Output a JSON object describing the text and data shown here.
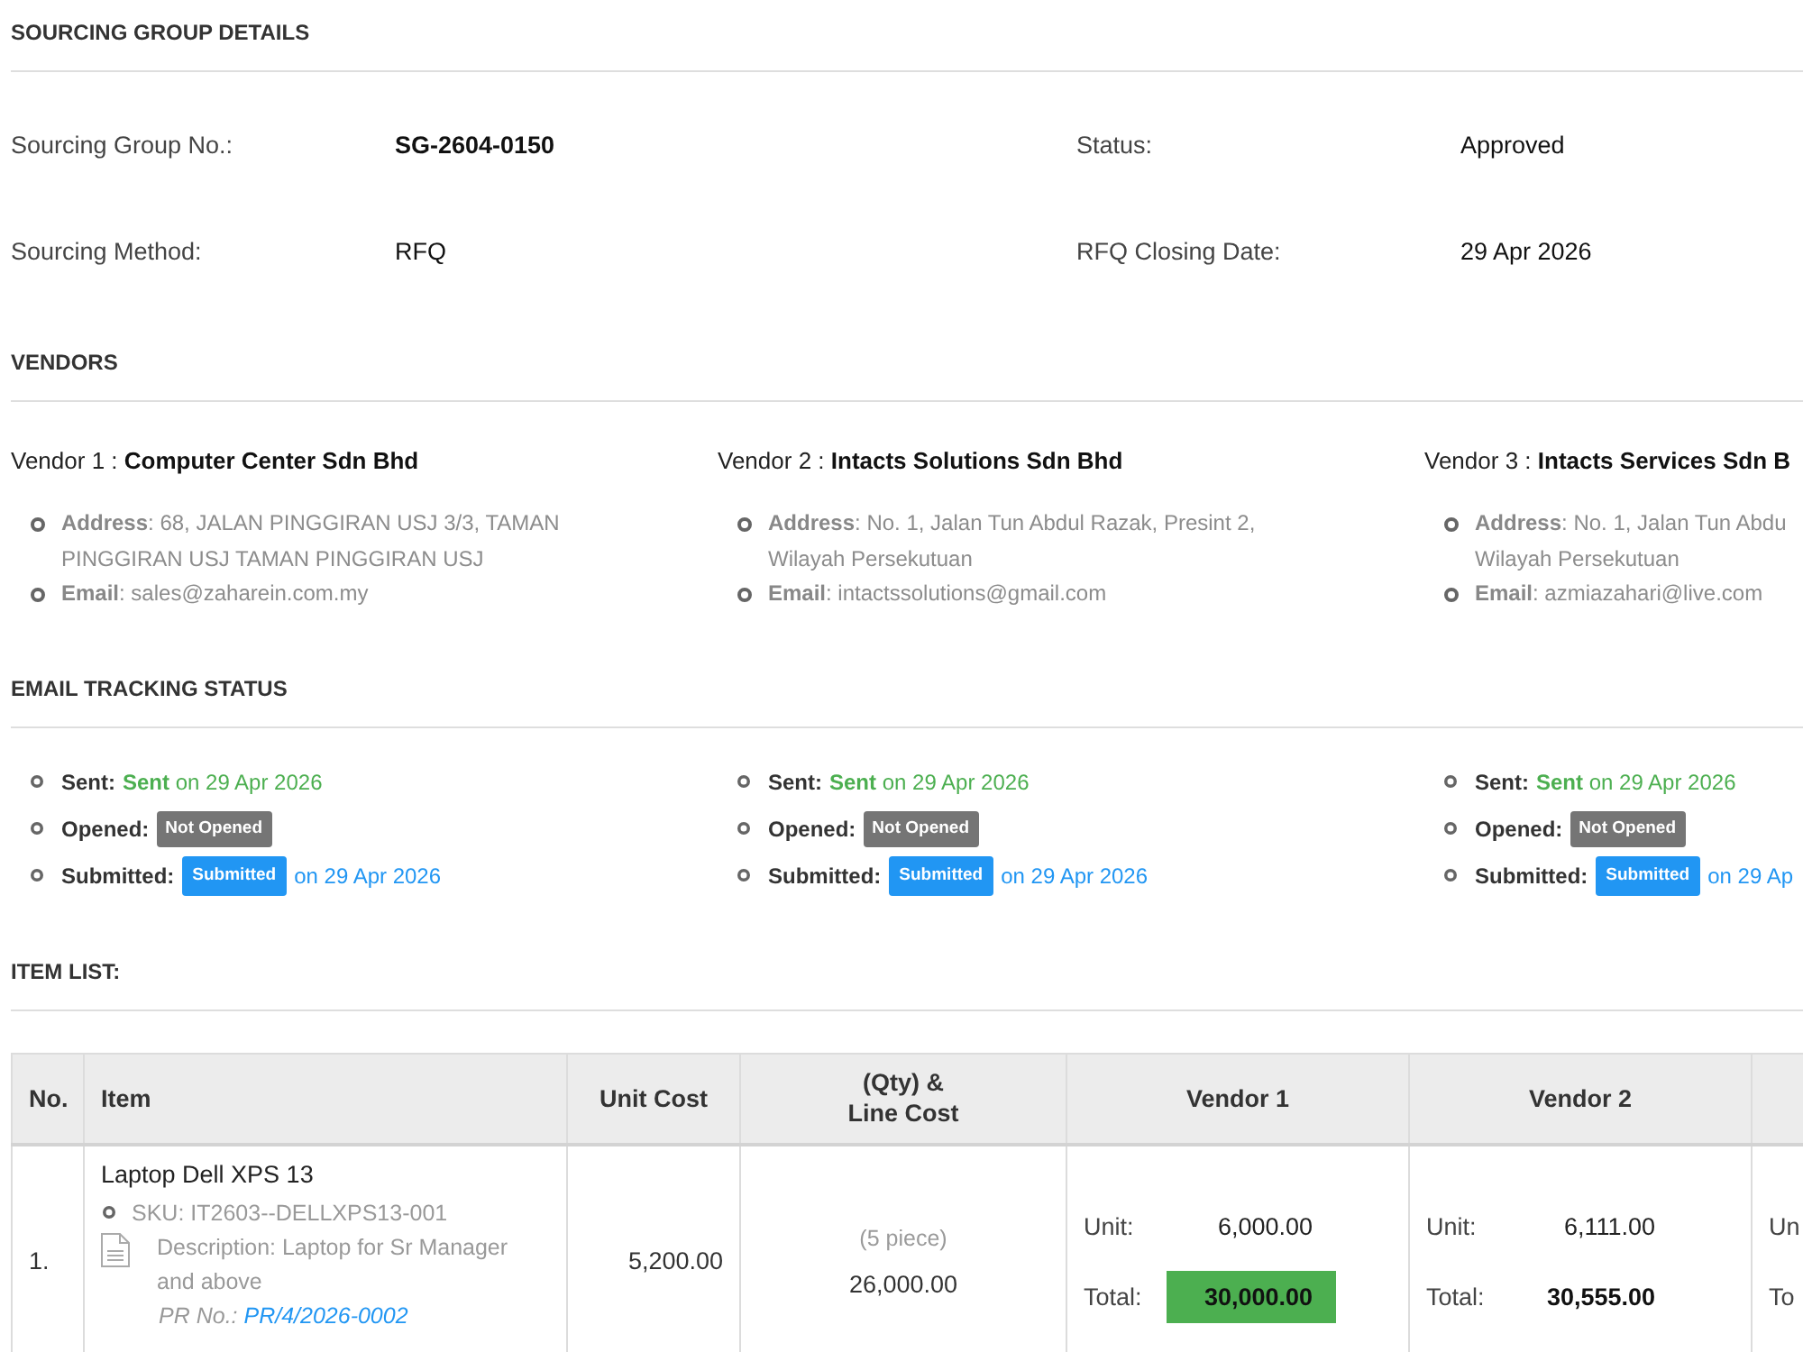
{
  "details": {
    "title": "SOURCING GROUP DETAILS",
    "fields": [
      {
        "label": "Sourcing Group No.:",
        "value": "SG-2604-0150",
        "bold": true
      },
      {
        "label": "Status:",
        "value": "Approved",
        "bold": false
      },
      {
        "label": "Sourcing Method:",
        "value": "RFQ",
        "bold": false
      },
      {
        "label": "RFQ Closing Date:",
        "value": "29 Apr 2026",
        "bold": false
      }
    ]
  },
  "vendors": {
    "title": "VENDORS",
    "items": [
      {
        "heading": "Vendor 1 : **Computer Center Sdn Bhd**",
        "details": [
          {
            "lines": [
              "**Address**: 68, JALAN PINGGIRAN USJ 3/3, TAMAN",
              "PINGGIRAN USJ TAMAN PINGGIRAN USJ"
            ]
          },
          {
            "lines": [
              "**Email**: sales@zaharein.com.my"
            ]
          }
        ]
      },
      {
        "heading": "Vendor 2 : **Intacts Solutions Sdn Bhd**",
        "details": [
          {
            "lines": [
              "**Address**: No. 1, Jalan Tun Abdul Razak, Presint 2,",
              "Wilayah Persekutuan"
            ]
          },
          {
            "lines": [
              "**Email**: intactssolutions@gmail.com"
            ]
          }
        ]
      },
      {
        "heading": "Vendor 3 : **Intacts Services Sdn B**",
        "details": [
          {
            "lines": [
              "**Address**: No. 1, Jalan Tun Abdu",
              "Wilayah Persekutuan"
            ]
          },
          {
            "lines": [
              "**Email**: azmiazahari@live.com"
            ]
          }
        ]
      }
    ]
  },
  "email_tracking": {
    "title": "EMAIL TRACKING STATUS",
    "vendors": [
      {
        "items": [
          {
            "kind": "text",
            "label": "Sent:",
            "value": "**Sent** on 29 Apr 2026",
            "color": "#4caf50"
          },
          {
            "kind": "badge",
            "label": "Opened:",
            "badge": "Not Opened",
            "color": "#757575"
          },
          {
            "kind": "badge",
            "label": "Submitted:",
            "badge": "Submitted",
            "note": "on 29 Apr 2026",
            "color": "#2196f3"
          }
        ]
      },
      {
        "items": [
          {
            "kind": "text",
            "label": "Sent:",
            "value": "**Sent** on 29 Apr 2026",
            "color": "#4caf50"
          },
          {
            "kind": "badge",
            "label": "Opened:",
            "badge": "Not Opened",
            "color": "#757575"
          },
          {
            "kind": "badge",
            "label": "Submitted:",
            "badge": "Submitted",
            "note": "on 29 Apr 2026",
            "color": "#2196f3"
          }
        ]
      },
      {
        "items": [
          {
            "kind": "text",
            "label": "Sent:",
            "value": "**Sent** on 29 Apr 2026",
            "color": "#4caf50"
          },
          {
            "kind": "badge",
            "label": "Opened:",
            "badge": "Not Opened",
            "color": "#757575"
          },
          {
            "kind": "badge",
            "label": "Submitted:",
            "badge": "Submitted",
            "note": "on 29 Ap",
            "color": "#2196f3"
          }
        ]
      }
    ]
  },
  "item_list": {
    "title": "ITEM LIST:",
    "columns": [
      "No.",
      "Item",
      "Unit Cost",
      "(Qty) &\nLine Cost",
      "Vendor 1",
      "Vendor 2"
    ],
    "rows": [
      {
        "no": "1.",
        "item": {
          "name": "Laptop Dell XPS 13",
          "sku": "SKU: IT2603--DELLXPS13-001",
          "description": "Description: Laptop for Sr Manager and above",
          "pr_label": "PR No.:",
          "pr_number": "PR/4/2026-0002"
        },
        "unit_cost": "5,200.00",
        "quantity": "(5 piece)",
        "line_cost": "26,000.00",
        "quotes": [
          {
            "unit_label": "Unit:",
            "unit": "6,000.00",
            "total_label": "Total:",
            "total": "30,000.00",
            "lowest": true
          },
          {
            "unit_label": "Unit:",
            "unit": "6,111.00",
            "total_label": "Total:",
            "total": "30,555.00",
            "lowest": false
          },
          {
            "unit_label": "Un",
            "total_label": "To"
          }
        ]
      }
    ]
  }
}
